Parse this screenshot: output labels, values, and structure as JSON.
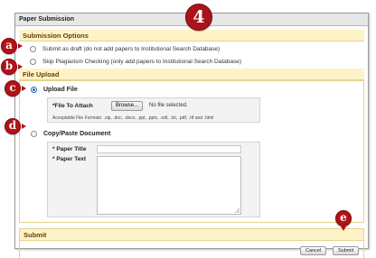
{
  "panel": {
    "title": "Paper Submission"
  },
  "submission_options": {
    "heading": "Submission Options",
    "draft_label": "Submit as draft (do not add papers to Institutional Search Database)",
    "skip_label": "Skip Plagiarism Checking (only add papers to Institutional Search Database)"
  },
  "file_upload": {
    "heading": "File Upload",
    "upload_file_label": "Upload File",
    "file_to_attach_label": "*File To Attach",
    "browse_label": "Browse...",
    "no_file_text": "No file selected.",
    "formats_text": "Acceptable File Formats: .zip, .doc, .docx, .ppt, .pptx, .odt, .txt, .pdf, .rtf and .html",
    "copy_paste_label": "Copy/Paste Document",
    "paper_title_label": "* Paper Title",
    "paper_title_value": "",
    "paper_text_label": "* Paper Text",
    "paper_text_value": ""
  },
  "submit_section": {
    "heading": "Submit",
    "cancel_label": "Cancel",
    "submit_label": "Submit"
  },
  "markers": {
    "title": "4",
    "a": "a",
    "b": "b",
    "c": "c",
    "d": "d",
    "e": "e"
  },
  "colors": {
    "marker": "#b31217",
    "section_header": "#fdf3c7",
    "section_text": "#6b3c00",
    "radio_selected": "#2a63b8"
  }
}
